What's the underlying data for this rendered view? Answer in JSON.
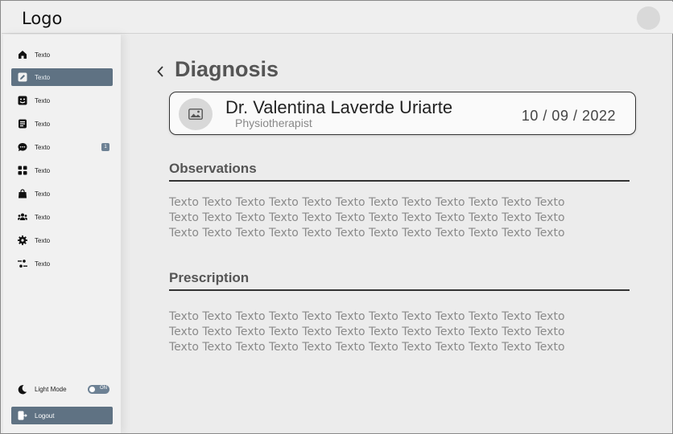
{
  "header": {
    "logo": "Logo"
  },
  "sidebar": {
    "items": [
      {
        "label": "Texto",
        "icon": "home-icon"
      },
      {
        "label": "Texto",
        "icon": "edit-icon",
        "active": true
      },
      {
        "label": "Texto",
        "icon": "face-icon"
      },
      {
        "label": "Texto",
        "icon": "document-icon"
      },
      {
        "label": "Texto",
        "icon": "chat-icon",
        "badge": "1"
      },
      {
        "label": "Texto",
        "icon": "grid-icon"
      },
      {
        "label": "Texto",
        "icon": "bag-icon"
      },
      {
        "label": "Texto",
        "icon": "users-icon"
      },
      {
        "label": "Texto",
        "icon": "gear-icon"
      },
      {
        "label": "Texto",
        "icon": "sliders-icon"
      }
    ],
    "light_mode_label": "Light Mode",
    "toggle_text": "ON",
    "logout_label": "Logout"
  },
  "main": {
    "title": "Diagnosis",
    "doctor": {
      "name": "Dr. Valentina Laverde Uriarte",
      "role": "Physiotherapist",
      "date": "10 / 09 / 2022"
    },
    "observations": {
      "title": "Observations",
      "lines": [
        "Texto Texto Texto Texto Texto Texto Texto Texto Texto Texto Texto Texto",
        "Texto Texto Texto Texto Texto Texto Texto Texto Texto Texto Texto Texto",
        "Texto Texto Texto Texto Texto Texto Texto Texto Texto Texto Texto Texto"
      ]
    },
    "prescription": {
      "title": "Prescription",
      "lines": [
        "Texto Texto Texto Texto Texto Texto Texto Texto Texto Texto Texto Texto",
        "Texto Texto Texto Texto Texto Texto Texto Texto Texto Texto Texto Texto",
        "Texto Texto Texto Texto Texto Texto Texto Texto Texto Texto Texto Texto"
      ]
    }
  },
  "colors": {
    "accent": "#5f7283",
    "heading": "#555555",
    "body_text": "#8a8a8a"
  }
}
